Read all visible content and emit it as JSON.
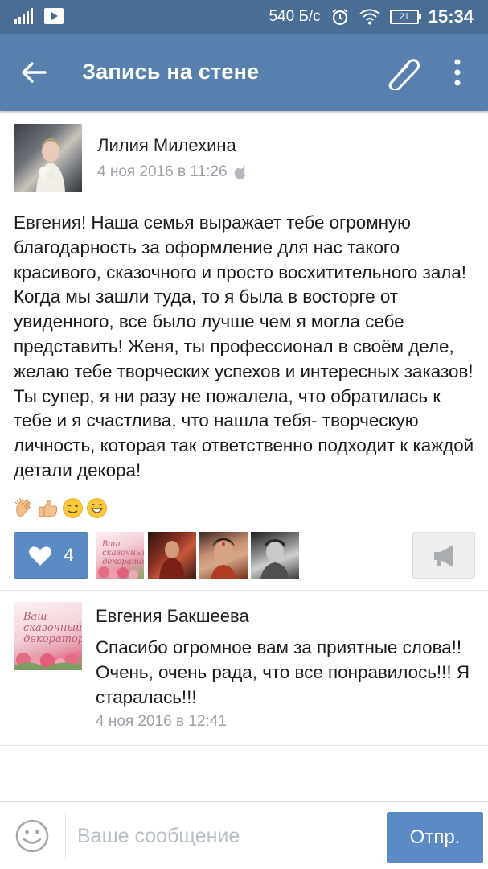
{
  "status_bar": {
    "speed": "540 Б/с",
    "battery": "21",
    "time": "15:34"
  },
  "app_bar": {
    "title": "Запись на стене",
    "icons": [
      "back-arrow-icon",
      "paperclip-icon",
      "more-vertical-icon"
    ]
  },
  "post": {
    "author": "Лилия Милехина",
    "date": "4 ноя 2016 в 11:26",
    "platform_icon": "apple-icon",
    "text": "Евгения! Наша семья выражает тебе огромную благодарность за оформление для нас такого красивого, сказочного и просто восхитительного зала! Когда мы зашли туда, то я была в восторге от увиденного, все было лучше чем я могла себе представить! Женя, ты профессионал в своём деле, желаю тебе творческих успехов и интересных заказов! Ты супер, я ни разу не пожалела, что обратилась к тебе и я счастлива, что нашла тебя- творческую личность, которая так ответственно подходит к каждой детали декора!",
    "emojis": [
      "clapping-hands-emoji",
      "thumbs-up-emoji",
      "winking-face-emoji",
      "grinning-face-emoji"
    ],
    "likes": {
      "count": "4",
      "icon": "heart-icon"
    },
    "liker_avatar_text": "Ваш сказочный декоратор",
    "share_icon": "megaphone-icon"
  },
  "comment": {
    "author": "Евгения Бакшеева",
    "avatar_text": "Ваш сказочный декоратор",
    "text": "Спасибо огромное вам за приятные слова!! Очень, очень рада, что все понравилось!!! Я старалась!!!",
    "date": "4 ноя 2016 в 12:41"
  },
  "compose": {
    "placeholder": "Ваше сообщение",
    "send_label": "Отпр.",
    "emoji_icon": "smiley-icon"
  },
  "colors": {
    "status_bar": "#4a6d96",
    "app_bar": "#5780ae",
    "accent": "#5b8ac4",
    "meta_text": "#9aa0a6"
  }
}
